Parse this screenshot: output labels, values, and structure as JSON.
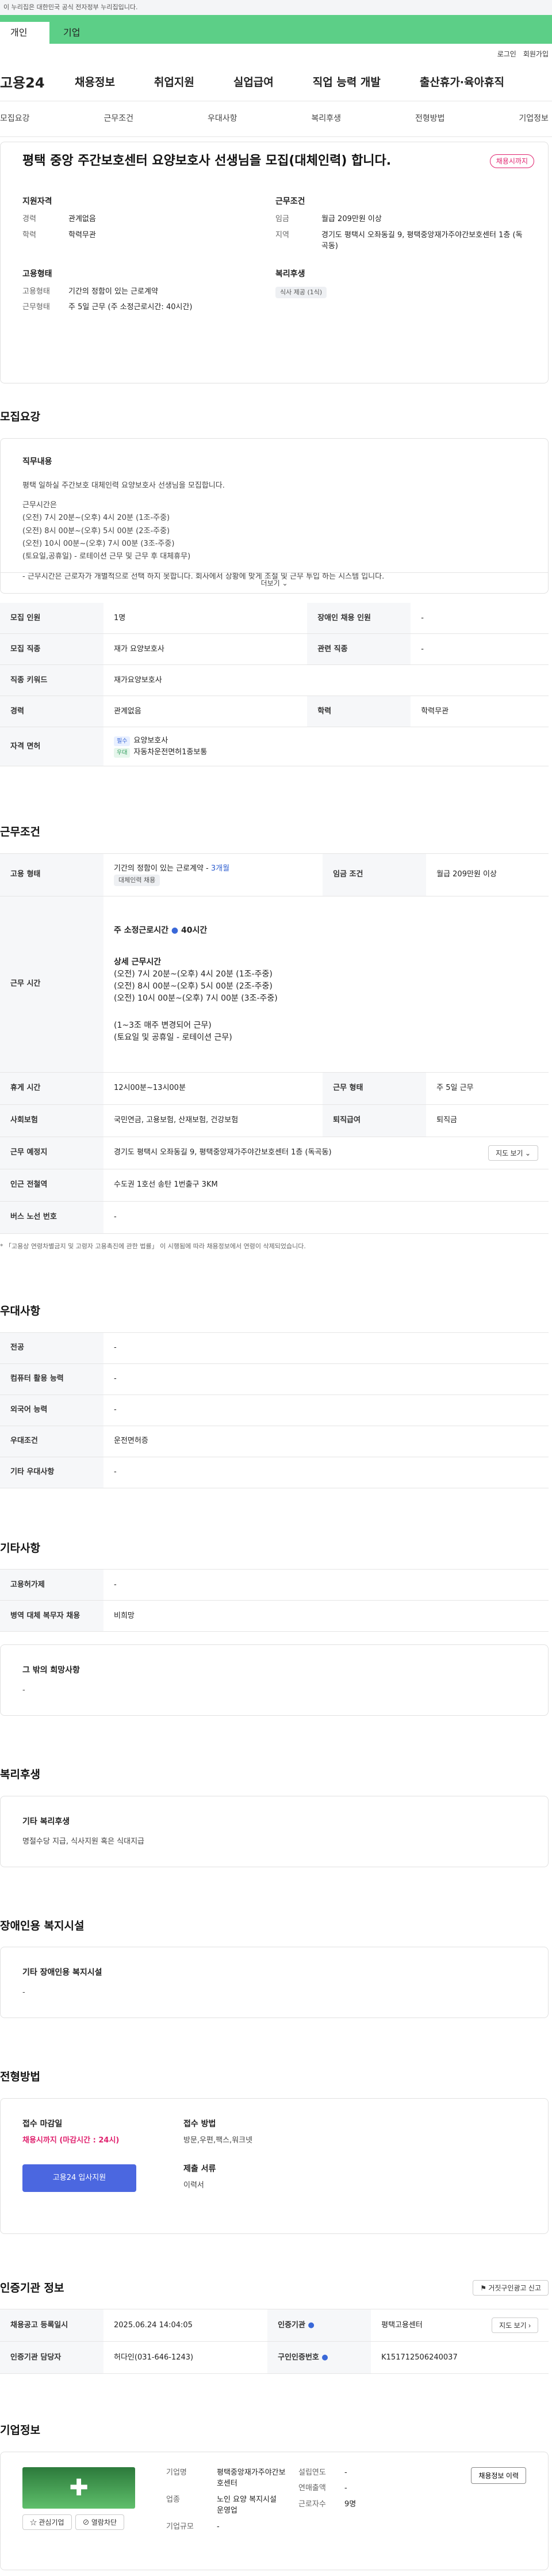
{
  "topbar": "이 누리집은 대한민국 공식 전자정부 누리집입니다.",
  "tabs": [
    "개인",
    "기업"
  ],
  "util": [
    "로그인",
    "회원가입"
  ],
  "logo": "고용24",
  "gnb": [
    "채용정보",
    "취업지원",
    "실업급여",
    "직업 능력 개발",
    "출산휴가·육아휴직"
  ],
  "anchors": [
    "모집요강",
    "근무조건",
    "우대사항",
    "복리후생",
    "전형방법",
    "기업정보"
  ],
  "header": {
    "title": "평택 중앙 주간보호센터 요양보호사 선생님을 모집(대체인력) 합니다.",
    "badge": "채용시까지",
    "qual": {
      "title": "지원자격",
      "career_k": "경력",
      "career_v": "관계없음",
      "edu_k": "학력",
      "edu_v": "학력무관"
    },
    "cond": {
      "title": "근무조건",
      "wage_k": "임금",
      "wage_v": "월급 209만원 이상",
      "loc_k": "지역",
      "loc_v": "경기도 평택시 오좌동길 9, 평택중앙재가주야간보호센터 1층 (독곡동)"
    },
    "emp": {
      "title": "고용형태",
      "type_k": "고용형태",
      "type_v": "기간의 정함이 있는 근로계약",
      "form_k": "근무형태",
      "form_v": "주 5일 근무 (주 소정근로시간: 40시간)"
    },
    "welfare": {
      "title": "복리후생",
      "tag": "식사 제공 (1식)"
    }
  },
  "recruit": {
    "title": "모집요강",
    "job_h": "직무내용",
    "lines": [
      "평택 일하실 주간보호 대체인력 요양보호사 선생님을 모집합니다.",
      "",
      "근무시간은",
      "(오전) 7시 20분~(오후) 4시 20분 (1조-주중)",
      "(오전) 8시 00분~(오후) 5시 00분 (2조-주중)",
      "(오전) 10시 00분~(오후) 7시 00분 (3조-주중)",
      "(토요일,공휴일) - 로테이션 근무 및 근무 후 대체휴무)",
      "",
      "- 근무시간은 근로자가 개별적으로 선택 하지 못합니다. 회사에서 상황에 맞게 조절 및 근무 투입 하는 시스템 입니다."
    ],
    "more": "더보기",
    "rows": {
      "count_k": "모집 인원",
      "count_v": "1명",
      "dis_k": "장애인 채용 인원",
      "dis_v": "-",
      "job_k": "모집 직종",
      "job_v": "재가 요양보호사",
      "rel_k": "관련 직종",
      "rel_v": "-",
      "kw_k": "직종 키워드",
      "kw_v": "재가요양보호사",
      "career_k": "경력",
      "career_v": "관계없음",
      "edu_k": "학력",
      "edu_v": "학력무관",
      "lic_k": "자격 면허",
      "lic_tag1": "필수",
      "lic1": "요양보호사",
      "lic_tag2": "우대",
      "lic2": "자동차운전면허1종보통"
    }
  },
  "work": {
    "title": "근무조건",
    "type_k": "고용 형태",
    "type_v": "기간의 정함이 있는 근로계약 - ",
    "type_months": "3개월",
    "type_tag": "대체인력 채용",
    "wage_k": "임금 조건",
    "wage_v": "월급 209만원 이상",
    "time_k": "근무 시간",
    "time_total": "주 소정근로시간",
    "time_hours": "40시간",
    "time_detail_h": "상세 근무시간",
    "time_lines": [
      "(오전) 7시 20분~(오후) 4시 20분 (1조-주중)",
      "(오전) 8시 00분~(오후) 5시 00분 (2조-주중)",
      "(오전) 10시 00분~(오후) 7시 00분 (3조-주중)",
      "",
      "(1~3조 매주 변경되어 근무)",
      "(토요일 및 공휴일 - 로테이션 근무)"
    ],
    "rest_k": "휴게 시간",
    "rest_v": "12시00분~13시00분",
    "form_k": "근무 형태",
    "form_v": "주 5일 근무",
    "ins_k": "사회보험",
    "ins_v": "국민연금, 고용보험, 산재보험, 건강보험",
    "ret_k": "퇴직급여",
    "ret_v": "퇴직금",
    "place_k": "근무 예정지",
    "place_v": "경기도 평택시 오좌동길 9, 평택중앙재가주야간보호센터 1층 (독곡동)",
    "map_btn": "지도 보기",
    "sub_k": "인근 전철역",
    "sub_v": "수도권 1호선 송탄 1번출구 3KM",
    "bus_k": "버스 노선 번호",
    "bus_v": "-",
    "note": "* 「고용상 연령차별금지 및 고령자 고용촉진에 관한 법률」 이 시행됨에 따라 채용정보에서 연령이 삭제되었습니다."
  },
  "pref": {
    "title": "우대사항",
    "rows": [
      [
        "전공",
        "-"
      ],
      [
        "컴퓨터 활용 능력",
        "-"
      ],
      [
        "외국어 능력",
        "-"
      ],
      [
        "우대조건",
        "운전면허증"
      ],
      [
        "기타 우대사항",
        "-"
      ]
    ]
  },
  "etc": {
    "title": "기타사항",
    "rows": [
      [
        "고용허가제",
        "-"
      ],
      [
        "병역 대체 복무자 채용",
        "비희망"
      ]
    ],
    "wish_h": "그 밖의 희망사항",
    "wish_v": "-"
  },
  "benefit": {
    "title": "복리후생",
    "h": "기타 복리후생",
    "v": "명절수당 지급, 식사지원 혹은 식대지급"
  },
  "disab": {
    "title": "장애인용 복지시설",
    "h": "기타 장애인용 복지시설",
    "v": "-"
  },
  "process": {
    "title": "전형방법",
    "deadline_h": "접수 마감일",
    "deadline_v": "채용시까지 (마감시간 : 24시)",
    "apply": "고용24 입사지원",
    "method_h": "접수 방법",
    "method_v": "방문,우편,팩스,워크넷",
    "docs_h": "제출 서류",
    "docs_v": "이력서"
  },
  "agency": {
    "title": "인증기관 정보",
    "report_btn": "거짓구인광고 신고",
    "reg_k": "채용공고 등록일시",
    "reg_v": "2025.06.24 14:04:05",
    "inst_k": "인증기관",
    "inst_v": "평택고용센터",
    "map_btn": "지도 보기",
    "mgr_k": "인증기관 담당자",
    "mgr_v": "허다인(031-646-1243)",
    "no_k": "구인인증번호",
    "no_v": "K151712506240037"
  },
  "company": {
    "title": "기업정보",
    "fav": "관심기업",
    "block": "열람차단",
    "name_k": "기업명",
    "name_v": "평택중앙재가주야간보호센터",
    "ind_k": "업종",
    "ind_v": "노인 요양 복지시설 운영업",
    "scale_k": "기업규모",
    "scale_v": "-",
    "est_k": "설립연도",
    "est_v": "-",
    "sales_k": "연매출액",
    "sales_v": "-",
    "emp_k": "근로자수",
    "emp_v": "9명",
    "info_btn": "채용정보 이력"
  }
}
